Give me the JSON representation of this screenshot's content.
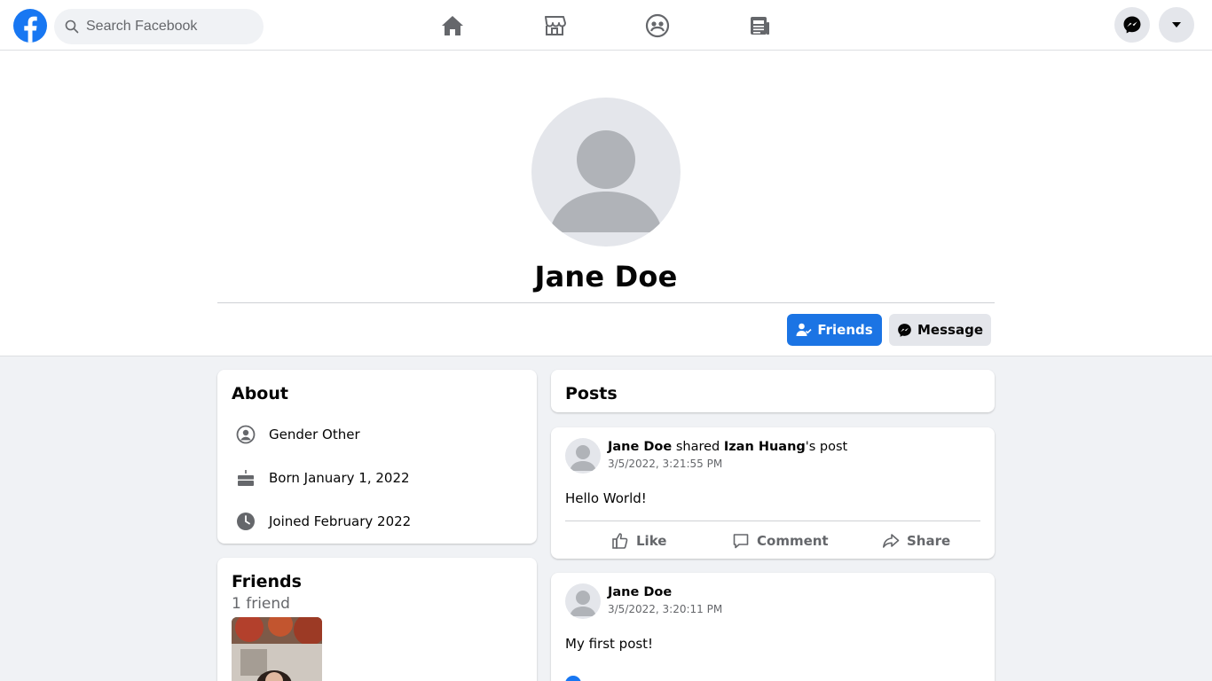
{
  "colors": {
    "brand": "#1877f2",
    "friends_button": "#1b74e4",
    "bg": "#f0f2f5"
  },
  "topnav": {
    "search_placeholder": "Search Facebook",
    "icons": [
      "facebook-logo",
      "search-icon",
      "home-icon",
      "marketplace-icon",
      "groups-icon",
      "news-icon",
      "messenger-icon",
      "caret-down-icon"
    ]
  },
  "profile": {
    "name": "Jane Doe",
    "friends_button": "Friends",
    "message_button": "Message"
  },
  "about": {
    "title": "About",
    "items": [
      {
        "icon": "user-circle-icon",
        "text": "Gender Other"
      },
      {
        "icon": "birthday-cake-icon",
        "text": "Born January 1, 2022"
      },
      {
        "icon": "clock-icon",
        "text": "Joined February 2022"
      }
    ]
  },
  "friends": {
    "title": "Friends",
    "count": "1 friend"
  },
  "posts": {
    "title": "Posts",
    "items": [
      {
        "author": "Jane Doe",
        "shared_text": "shared",
        "original_author": "Izan Huang",
        "possessive": "'s post",
        "time": "3/5/2022, 3:21:55 PM",
        "body": "Hello World!",
        "actions": {
          "like": "Like",
          "comment": "Comment",
          "share": "Share"
        }
      },
      {
        "author": "Jane Doe",
        "time": "3/5/2022, 3:20:11 PM",
        "body": "My first post!"
      }
    ]
  }
}
